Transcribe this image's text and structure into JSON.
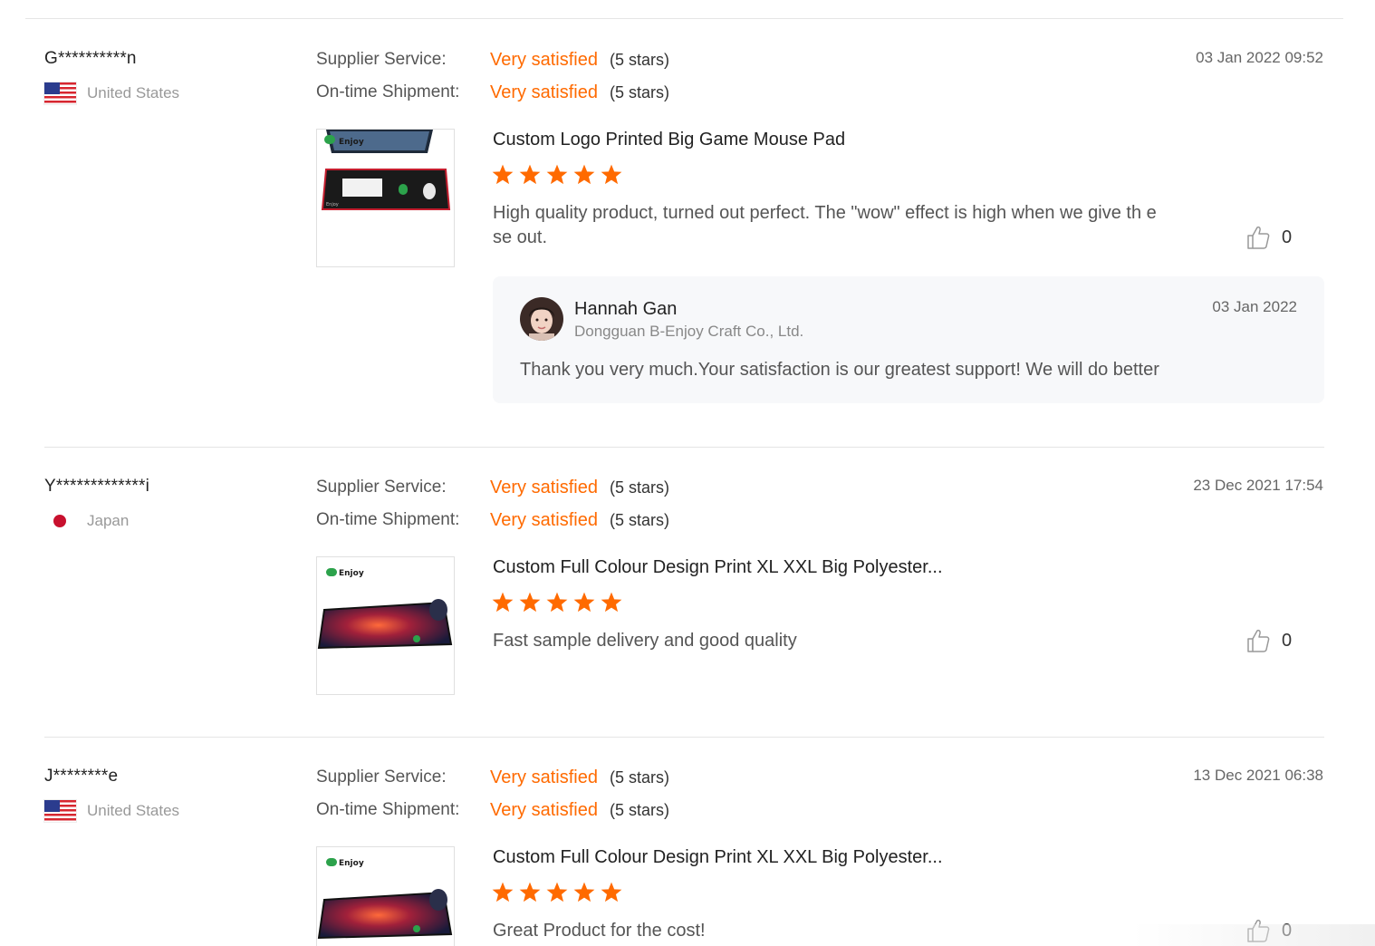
{
  "colors": {
    "accent": "#ff6a00",
    "star": "#ff6a00",
    "reply_bg": "#f7f8fa",
    "divider": "#e5e5e5"
  },
  "reviews": [
    {
      "buyer": "G**********n",
      "country": "United States",
      "flag": "us-flag-icon",
      "date": "03 Jan 2022 09:52",
      "supplier_service_label": "Supplier Service:",
      "supplier_service_value": "Very satisfied",
      "supplier_service_stars": "(5 stars)",
      "shipment_label": "On-time Shipment:",
      "shipment_value": "Very satisfied",
      "shipment_stars": "(5 stars)",
      "product_title": "Custom Logo Printed Big Game Mouse Pad",
      "rating": 5,
      "text": "High quality product, turned out perfect. The \"wow\" effect is high when we give th ese out.",
      "likes": "0",
      "reply": {
        "name": "Hannah Gan",
        "company": "Dongguan B-Enjoy Craft Co., Ltd.",
        "date": "03 Jan 2022",
        "text": "Thank you very much.Your satisfaction is our greatest support! We will do better"
      }
    },
    {
      "buyer": "Y*************i",
      "country": "Japan",
      "flag": "jp-flag-icon",
      "date": "23 Dec 2021 17:54",
      "supplier_service_label": "Supplier Service:",
      "supplier_service_value": "Very satisfied",
      "supplier_service_stars": "(5 stars)",
      "shipment_label": "On-time Shipment:",
      "shipment_value": "Very satisfied",
      "shipment_stars": "(5 stars)",
      "product_title": "Custom Full Colour Design Print XL XXL Big Polyester...",
      "rating": 5,
      "text": "Fast sample delivery and good quality",
      "likes": "0"
    },
    {
      "buyer": "J********e",
      "country": "United States",
      "flag": "us-flag-icon",
      "date": "13 Dec 2021 06:38",
      "supplier_service_label": "Supplier Service:",
      "supplier_service_value": "Very satisfied",
      "supplier_service_stars": "(5 stars)",
      "shipment_label": "On-time Shipment:",
      "shipment_value": "Very satisfied",
      "shipment_stars": "(5 stars)",
      "product_title": "Custom Full Colour Design Print XL XXL Big Polyester...",
      "rating": 5,
      "text": "Great Product for the cost!",
      "likes": "0"
    }
  ],
  "icons": {
    "like": "thumbs-up-icon",
    "star": "star-icon"
  }
}
